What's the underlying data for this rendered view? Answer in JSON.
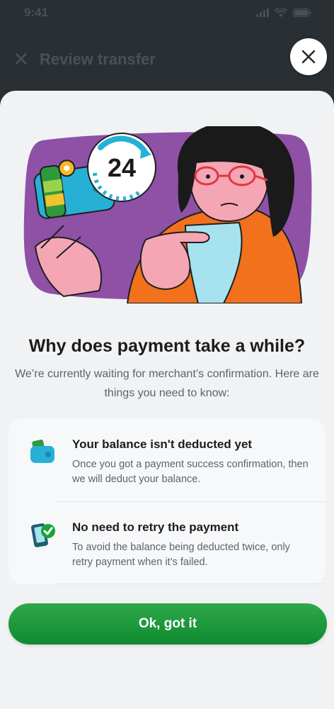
{
  "status_bar": {
    "time": "9:41",
    "icons": [
      "signal-icon",
      "wifi-icon",
      "battery-icon"
    ]
  },
  "background_screen": {
    "title": "Review transfer",
    "close_icon": "close-icon"
  },
  "sheet": {
    "close_icon": "close-icon",
    "illustration_badge": "24",
    "title": "Why does payment take a while?",
    "subtitle": "We’re currently waiting for merchant’s confirmation. Here are things you need to know:",
    "info_items": [
      {
        "icon": "wallet-icon",
        "title": "Your balance isn't deducted yet",
        "description": "Once you got a payment success confirmation, then we will deduct your balance."
      },
      {
        "icon": "phone-check-icon",
        "title": "No need to retry the payment",
        "description": "To avoid the balance being deducted twice, only retry payment when it’s failed."
      }
    ],
    "button_label": "Ok, got it"
  },
  "colors": {
    "accent_green": "#0f8a2f",
    "illustration_purple": "#8e51a6",
    "sheet_bg": "#f1f2f4"
  }
}
